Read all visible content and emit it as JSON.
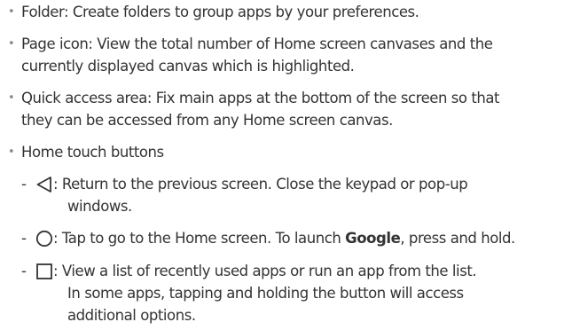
{
  "items": [
    {
      "lines": [
        "Folder: Create folders to group apps by your preferences."
      ]
    },
    {
      "lines": [
        "Page icon: View the total number of Home screen canvases and the",
        "currently displayed canvas which is highlighted."
      ]
    },
    {
      "lines": [
        "Quick access area: Fix main apps at the bottom of the screen so that",
        "they can be accessed from any Home screen canvas."
      ]
    },
    {
      "lines": [
        "Home touch buttons"
      ]
    }
  ],
  "sub_items": [
    {
      "icon": "back-triangle-icon",
      "lines": [
        ": Return to the previous screen. Close the keypad or pop-up",
        "windows."
      ]
    },
    {
      "icon": "home-circle-icon",
      "line1_prefix": ": Tap to go to the Home screen. To launch ",
      "line1_bold": "Google",
      "line1_suffix": ", press and hold."
    },
    {
      "icon": "recents-square-icon",
      "lines": [
        ": View a list of recently used apps or run an app from the list.",
        "In some apps, tapping and holding the button will access",
        "additional options."
      ]
    }
  ],
  "bullet_char": "•",
  "dash_char": "-"
}
